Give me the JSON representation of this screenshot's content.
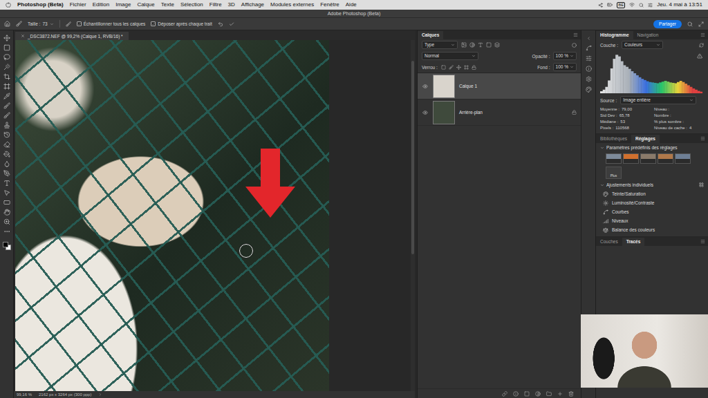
{
  "menu_bar": {
    "app": "Photoshop (Beta)",
    "items": [
      "Fichier",
      "Edition",
      "Image",
      "Calque",
      "Texte",
      "Sélection",
      "Filtre",
      "3D",
      "Affichage",
      "Modules externes",
      "Fenêtre",
      "Aide"
    ],
    "input_source": "BE",
    "clock": "Jeu. 4 mai à 13:51"
  },
  "window": {
    "title": "Adobe Photoshop (Beta)"
  },
  "options_bar": {
    "size_label": "Taille :",
    "size": "73",
    "checkboxes": [
      {
        "label": "Échantillonner tous les calques",
        "checked": true
      },
      {
        "label": "Déposer après chaque trait",
        "checked": true
      }
    ],
    "share_button": "Partager"
  },
  "toolbar": {
    "foreground_color": "#000000",
    "background_color": "#ffffff"
  },
  "document": {
    "tab": "_DSC3872.NEF @ 99,2% (Calque 1, RVB/16) *",
    "zoom": "99,16 %",
    "size_info": "2162 px x 3264 px (300 ppp)"
  },
  "layers_panel": {
    "tabs": [
      {
        "label": "Calques",
        "selected": true
      }
    ],
    "filter": "Type",
    "blend_mode": "Normal",
    "opacity_label": "Opacité :",
    "opacity": "100 %",
    "lock_label": "Verrou :",
    "fill_label": "Fond :",
    "fill": "100 %",
    "layers": [
      {
        "name": "Calque 1",
        "selected": true,
        "visible": true,
        "locked": false,
        "color": "#d9d4cc"
      },
      {
        "name": "Arrière-plan",
        "selected": false,
        "visible": true,
        "locked": true,
        "color": "#3f4a3c"
      }
    ]
  },
  "histogram_panel": {
    "tabs": [
      {
        "label": "Histogramme",
        "selected": true
      },
      {
        "label": "Navigation",
        "selected": false
      }
    ],
    "channel_label": "Couche :",
    "channel": "Couleurs",
    "histogram": {
      "values": [
        5,
        9,
        16,
        32,
        62,
        86,
        96,
        92,
        80,
        70,
        66,
        61,
        55,
        50,
        45,
        40,
        36,
        33,
        30,
        28,
        27,
        26,
        25,
        27,
        29,
        31,
        29,
        27,
        26,
        25,
        28,
        31,
        28,
        24,
        20,
        16,
        12,
        9,
        6,
        4
      ]
    },
    "source_label": "Source :",
    "source": "Image entière",
    "stats_left": [
      {
        "label": "Moyenne :",
        "value": "79,00"
      },
      {
        "label": "Std Dev :",
        "value": "65,78"
      },
      {
        "label": "Médiane :",
        "value": "53"
      },
      {
        "label": "Pixels :",
        "value": "110568"
      }
    ],
    "stats_right": [
      {
        "label": "Niveau :",
        "value": ""
      },
      {
        "label": "Nombre :",
        "value": ""
      },
      {
        "label": "% plus sombre :",
        "value": ""
      },
      {
        "label": "Niveau de cache :",
        "value": "4"
      }
    ]
  },
  "adjustments_panel": {
    "tabs": [
      {
        "label": "Bibliothèques",
        "selected": false
      },
      {
        "label": "Réglages",
        "selected": true
      }
    ],
    "presets_title": "Paramètres prédéfinis des réglages",
    "presets": [
      {
        "color": "#7d8a99"
      },
      {
        "color": "#d0702e"
      },
      {
        "color": "#8a7a6a"
      },
      {
        "color": "#b0784a"
      },
      {
        "color": "#6e7f95"
      }
    ],
    "more_label": "Plus",
    "individual_title": "Ajustements individuels",
    "adjustments": [
      "Teinte/Saturation",
      "Luminosité/Contraste",
      "Courbes",
      "Niveaux",
      "Balance des couleurs"
    ]
  },
  "bottom_panel": {
    "tabs": [
      {
        "label": "Couches",
        "selected": false
      },
      {
        "label": "Tracés",
        "selected": true
      }
    ]
  }
}
